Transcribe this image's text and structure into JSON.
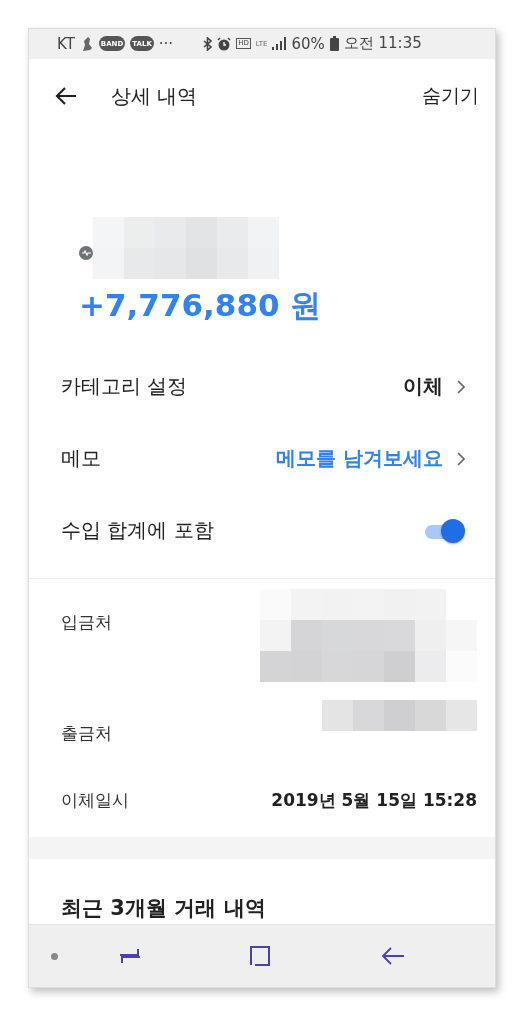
{
  "status_bar": {
    "carrier": "KT",
    "app_badges": [
      "BAND",
      "TALK"
    ],
    "overflow": "···",
    "hd": "HD",
    "network": "LTE",
    "battery": "60%",
    "time": "오전 11:35"
  },
  "header": {
    "title": "상세 내역",
    "action": "숨기기"
  },
  "hero": {
    "amount": "+7,776,880 원"
  },
  "settings": [
    {
      "kind": "link",
      "label": "카테고리 설정",
      "value": "이체"
    },
    {
      "kind": "link",
      "label": "메모",
      "placeholder": "메모를 남겨보세요"
    },
    {
      "kind": "toggle",
      "label": "수입 합계에 포함",
      "on": true
    }
  ],
  "details": [
    {
      "kind": "redacted",
      "label": "입금처"
    },
    {
      "kind": "redacted",
      "label": "출금처"
    },
    {
      "kind": "text",
      "label": "이체일시",
      "value": "2019년 5월 15일 15:28"
    }
  ],
  "section_title": "최근 3개월 거래 내역"
}
